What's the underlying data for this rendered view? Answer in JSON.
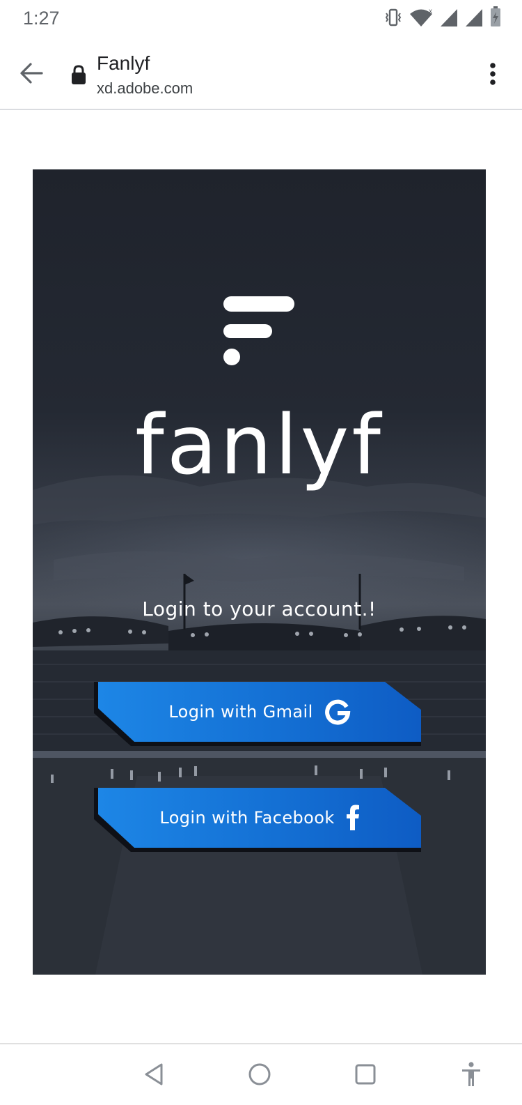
{
  "status_bar": {
    "time": "1:27",
    "icons": [
      "vibrate-icon",
      "wifi-icon",
      "signal-icon",
      "signal-icon",
      "battery-icon"
    ]
  },
  "browser": {
    "page_title": "Fanlyf",
    "url": "xd.adobe.com",
    "icons": {
      "back": "arrow-left-icon",
      "secure": "lock-icon",
      "menu": "more-vertical-icon"
    }
  },
  "app": {
    "brand_name": "fanlyf",
    "login_prompt": "Login to your account.!",
    "buttons": {
      "gmail_label": "Login with Gmail",
      "facebook_label": "Login with Facebook"
    },
    "colors": {
      "button_blue": "#1470d4",
      "background_dark": "#242933",
      "text": "#ffffff"
    }
  },
  "nav_bar": {
    "icons": [
      "back-triangle-icon",
      "home-circle-icon",
      "recents-square-icon",
      "accessibility-icon"
    ]
  }
}
